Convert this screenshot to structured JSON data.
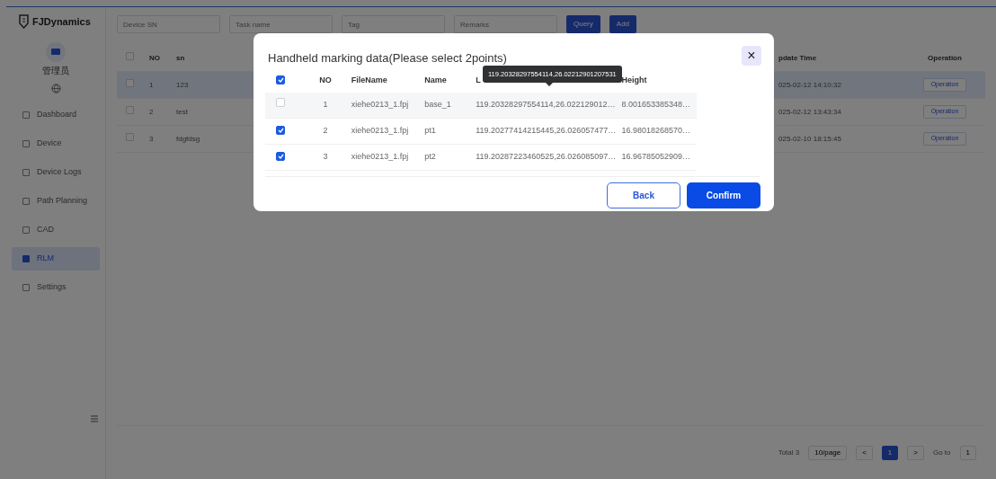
{
  "sidebar": {
    "logo": "FJDynamics",
    "user": "管理员",
    "items": [
      {
        "label": "Dashboard",
        "selected": false
      },
      {
        "label": "Device",
        "selected": false
      },
      {
        "label": "Device Logs",
        "selected": false
      },
      {
        "label": "Path Planning",
        "selected": false
      },
      {
        "label": "CAD",
        "selected": false
      },
      {
        "label": "RLM",
        "selected": true
      },
      {
        "label": "Settings",
        "selected": false
      }
    ]
  },
  "filters": {
    "fields": [
      {
        "placeholder": "Device SN"
      },
      {
        "placeholder": "Task name"
      },
      {
        "placeholder": "Tag"
      },
      {
        "placeholder": "Remarks"
      }
    ],
    "buttons": [
      "Query",
      "Add"
    ]
  },
  "table": {
    "all_checked": false,
    "columns": [
      "NO",
      "sn",
      "pdate Time",
      "Operation"
    ],
    "rows": [
      {
        "no": "1",
        "sn": "123",
        "time": "025-02-12 14:10:32",
        "operation": "Operation",
        "selected": true
      },
      {
        "no": "2",
        "sn": "test",
        "time": "025-02-12 13:43:34",
        "operation": "Operation",
        "selected": false
      },
      {
        "no": "3",
        "sn": "fdgfdsg",
        "time": "025-02-10 18:15:45",
        "operation": "Operation",
        "selected": false
      }
    ]
  },
  "pagination": {
    "total": "Total 3",
    "page_size": "10/page",
    "prev": "<",
    "current": "1",
    "next": ">",
    "goto_label": "Go to",
    "goto_value": "1"
  },
  "dialog": {
    "title": "Handheld marking data(Please select 2points)",
    "close": "×",
    "columns": [
      "NO",
      "FileName",
      "Name",
      "L",
      "Height"
    ],
    "all_checked": true,
    "rows": [
      {
        "no": "1",
        "file": "xiehe0213_1.fpj",
        "name": "base_1",
        "location": "119.20328297554114,26.022129012…",
        "height": "8.001653385348…",
        "checked": false
      },
      {
        "no": "2",
        "file": "xiehe0213_1.fpj",
        "name": "pt1",
        "location": "119.20277414215445,26.026057477…",
        "height": "16.98018268570…",
        "checked": true
      },
      {
        "no": "3",
        "file": "xiehe0213_1.fpj",
        "name": "pt2",
        "location": "119.20287223460525,26.026085097…",
        "height": "16.96785052909…",
        "checked": true
      }
    ],
    "tooltip": "119.20328297554114,26.02212901207531",
    "buttons": [
      "Back",
      "Confirm"
    ]
  }
}
